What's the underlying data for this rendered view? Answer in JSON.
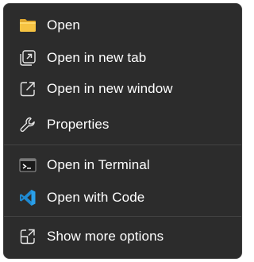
{
  "menu": {
    "items": [
      {
        "label": "Open",
        "icon": "folder-icon",
        "color": "#f6c342"
      },
      {
        "label": "Open in new tab",
        "icon": "open-in-new-tab-icon"
      },
      {
        "label": "Open in new window",
        "icon": "open-in-new-window-icon"
      },
      {
        "label": "Properties",
        "icon": "wrench-icon"
      },
      {
        "label": "Open in Terminal",
        "icon": "terminal-icon"
      },
      {
        "label": "Open with Code",
        "icon": "vscode-icon",
        "color": "#1f8ad2"
      },
      {
        "label": "Show more options",
        "icon": "show-more-options-icon"
      }
    ]
  }
}
